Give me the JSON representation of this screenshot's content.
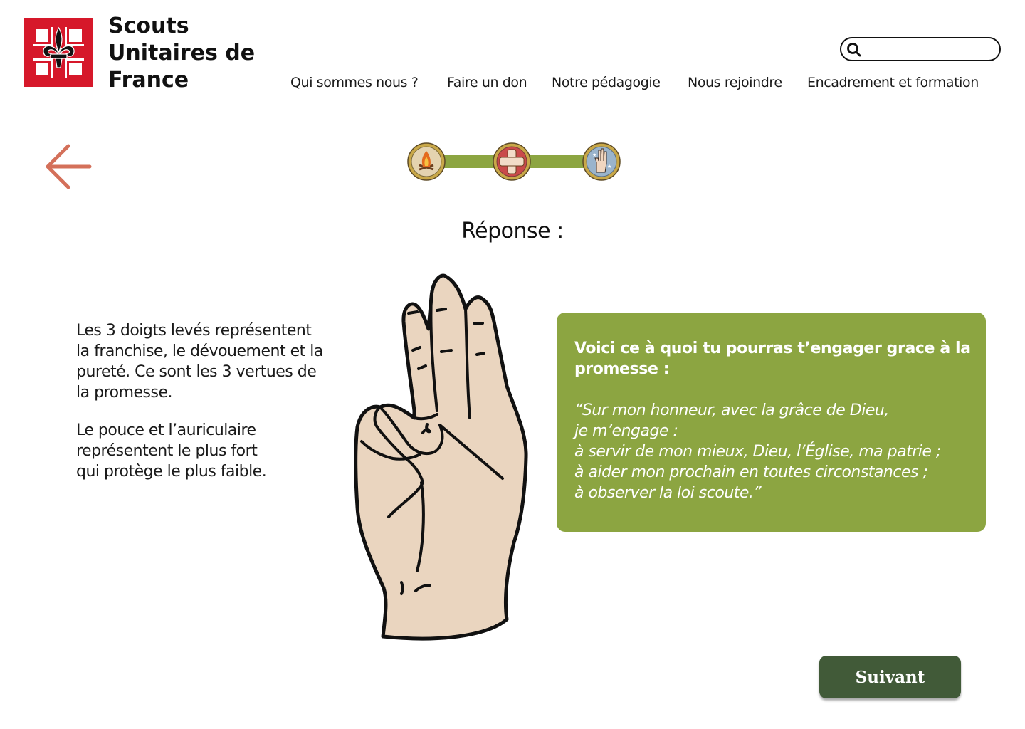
{
  "brand": {
    "name_lines": [
      "Scouts",
      "Unitaires de",
      "France"
    ],
    "logo_icon": "sufr-cross-fleur-de-lis-logo",
    "colors": {
      "logo_red": "#d6182a"
    }
  },
  "search": {
    "icon": "search-icon",
    "value": "",
    "placeholder": ""
  },
  "nav": {
    "items": [
      {
        "label": "Qui sommes nous ?"
      },
      {
        "label": "Faire un don"
      },
      {
        "label": "Notre pédagogie"
      },
      {
        "label": "Nous rejoindre"
      },
      {
        "label": "Encadrement et formation"
      }
    ]
  },
  "back": {
    "icon": "arrow-left-icon",
    "color": "#d4705a"
  },
  "progress": {
    "steps": [
      {
        "icon": "campfire-badge-icon"
      },
      {
        "icon": "first-aid-badge-icon"
      },
      {
        "icon": "scout-salute-badge-icon"
      }
    ],
    "track_color": "#8ca541"
  },
  "answer": {
    "title": "Réponse :"
  },
  "explanation": {
    "paragraphs": [
      "Les 3 doigts levés représentent\nla franchise, le dévouement et la\npureté. Ce sont les 3 vertues de\nla promesse.",
      "Le pouce et l’auriculaire\nreprésentent le plus fort\nqui protège le plus faible."
    ]
  },
  "illustration": {
    "icon": "scout-salute-hand-icon"
  },
  "promise_card": {
    "heading": "Voici ce à quoi tu pourras t’engager grace à la promesse :",
    "quote": "“Sur mon honneur, avec la grâce de Dieu,\n je m’engage :\nà servir de mon mieux, Dieu, l’Église, ma patrie ;\nà aider mon prochain en toutes circonstances ;\nà observer la loi scoute.”",
    "background": "#8ca541"
  },
  "next_button": {
    "label": "Suivant",
    "background": "#415a38"
  }
}
